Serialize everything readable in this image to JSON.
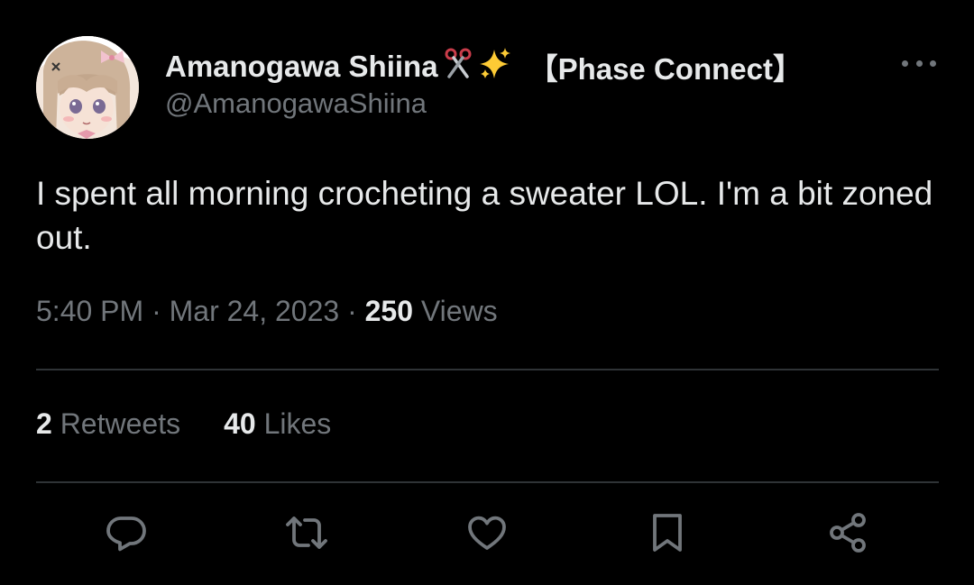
{
  "author": {
    "display_name": "Amanogawa Shiina",
    "emoji_scissors": "✂️",
    "emoji_sparkles": "✨",
    "affiliation_tag": "【Phase Connect】",
    "handle": "@AmanogawaShiina"
  },
  "tweet": {
    "text": "I spent all morning crocheting a sweater LOL. I'm a bit zoned out.",
    "time": "5:40 PM",
    "separator": "·",
    "date": "Mar 24, 2023",
    "views_count": "250",
    "views_label": "Views"
  },
  "stats": {
    "retweets_count": "2",
    "retweets_label": "Retweets",
    "likes_count": "40",
    "likes_label": "Likes"
  },
  "actions": [
    "reply-icon",
    "retweet-icon",
    "like-icon",
    "bookmark-icon",
    "share-icon"
  ],
  "colors": {
    "background": "#000000",
    "primary_text": "#e7e9ea",
    "secondary_text": "#71767b",
    "divider": "#2f3336",
    "icon": "#71767b"
  }
}
